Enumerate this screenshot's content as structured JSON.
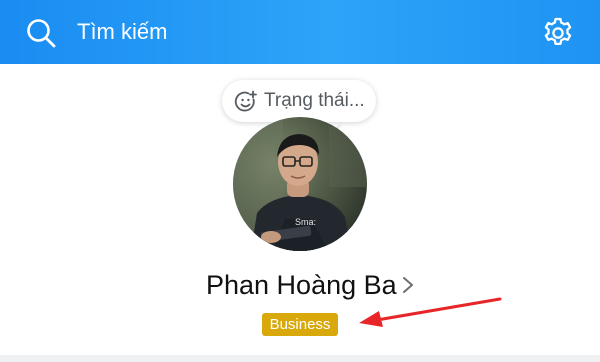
{
  "header": {
    "search_placeholder": "Tìm kiếm",
    "search_icon": "search-icon",
    "settings_icon": "gear-icon",
    "gradient_start": "#1a8cf2",
    "gradient_end": "#2da4f8"
  },
  "profile": {
    "status_prompt": "Trạng thái...",
    "status_icon": "smile-plus-icon",
    "name": "Phan Hoàng Ba",
    "badge": "Business",
    "badge_color": "#d9a80a"
  },
  "annotation": {
    "arrow_color": "#e8262a"
  }
}
